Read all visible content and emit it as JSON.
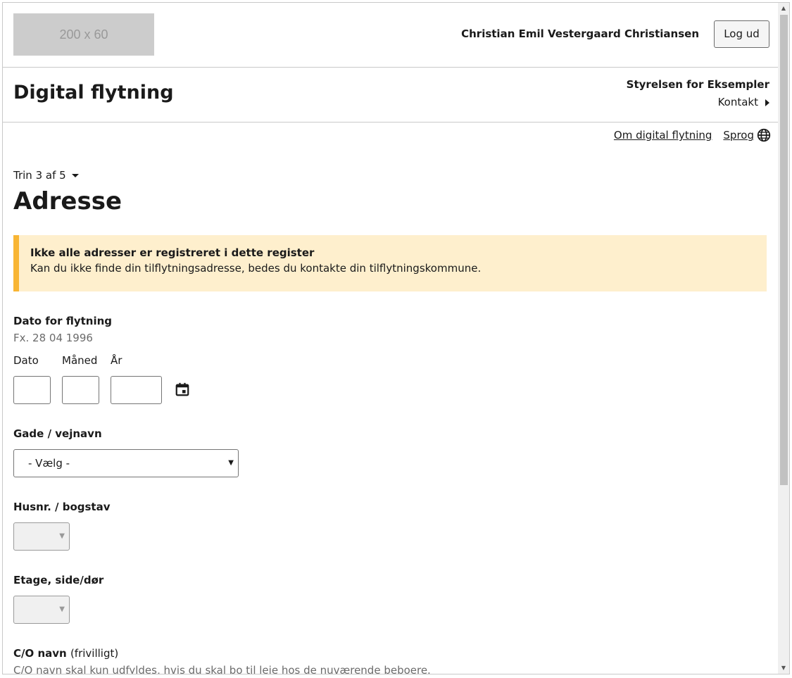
{
  "header": {
    "logo_text": "200 x 60",
    "user_name": "Christian Emil Vestergaard Christiansen",
    "logout_label": "Log ud"
  },
  "solution": {
    "title": "Digital flytning",
    "authority": "Styrelsen for Eksempler",
    "contact_label": "Kontakt"
  },
  "util_links": {
    "about": "Om digital flytning",
    "language": "Sprog"
  },
  "step": {
    "label": "Trin 3 af 5"
  },
  "page_title": "Adresse",
  "alert": {
    "heading": "Ikke alle adresser er registreret i dette register",
    "text": "Kan du ikke finde din tilflytningsadresse, bedes du kontakte din tilflytningskommune."
  },
  "form": {
    "date": {
      "label": "Dato for flytning",
      "hint": "Fx. 28 04 1996",
      "day_label": "Dato",
      "month_label": "Måned",
      "year_label": "År"
    },
    "street": {
      "label": "Gade / vejnavn",
      "selected": "- Vælg -"
    },
    "house_number": {
      "label": "Husnr. / bogstav"
    },
    "floor": {
      "label": "Etage, side/dør"
    },
    "co": {
      "label": "C/O navn",
      "optional": "(frivilligt)",
      "hint": "C/O navn skal kun udfyldes, hvis du skal bo til leje hos de nuværende beboere."
    }
  },
  "colors": {
    "alert_background": "#feefcd",
    "alert_border": "#f8b534",
    "logo_placeholder": "#cccccc"
  }
}
